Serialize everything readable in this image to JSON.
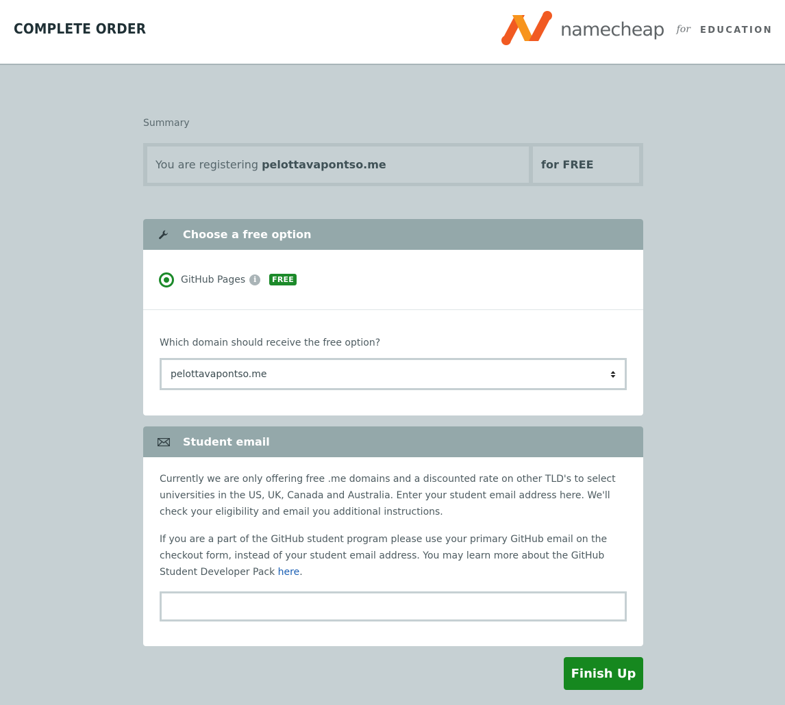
{
  "header": {
    "title": "COMPLETE ORDER",
    "brand_name": "namecheap",
    "brand_for": "for",
    "brand_suffix": "EDUCATION",
    "logo_icon": "namecheap-n-logo",
    "logo_colors": [
      "#f15a22",
      "#f7941d"
    ]
  },
  "summary": {
    "label": "Summary",
    "registering_prefix": "You are registering",
    "domain": "pelottavapontso.me",
    "price": "for FREE"
  },
  "free_option": {
    "heading": "Choose a free option",
    "heading_icon": "wrench-icon",
    "option_label": "GitHub Pages",
    "option_selected": true,
    "info_icon": "info-icon",
    "badge": "FREE",
    "question": "Which domain should receive the free option?",
    "selected_domain": "pelottavapontso.me"
  },
  "student_email": {
    "heading": "Student email",
    "heading_icon": "envelope-icon",
    "paragraph1": "Currently we are only offering free .me domains and a discounted rate on other TLD's to select universities in the US, UK, Canada and Australia. Enter your student email address here. We'll check your eligibility and email you additional instructions.",
    "paragraph2": "If you are a part of the GitHub student program please use your primary GitHub email on the checkout form, instead of your student email address. You may learn more about the GitHub Student Developer Pack",
    "link_text": "here",
    "link_suffix": ".",
    "email_value": ""
  },
  "actions": {
    "finish_label": "Finish Up"
  },
  "colors": {
    "accent_green": "#16881f",
    "panel_header": "#94a8aa",
    "background": "#c6d0d3"
  }
}
